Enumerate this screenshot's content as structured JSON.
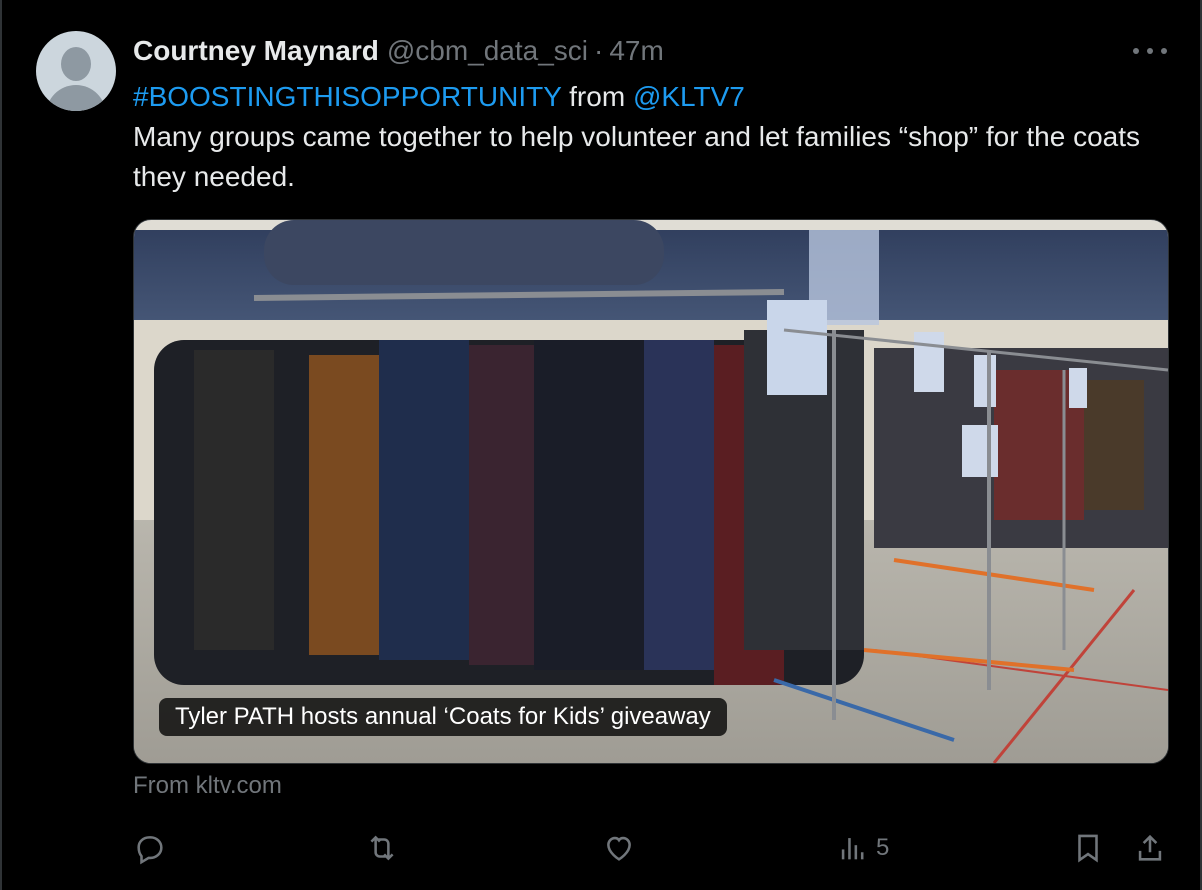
{
  "tweet": {
    "author_name": "Courtney Maynard",
    "handle": "@cbm_data_sci",
    "separator": "·",
    "time": "47m",
    "hashtag": "#BOOSTINGTHISOPPORTUNITY",
    "from_word": "from",
    "mention": "@KLTV7",
    "body": "Many groups came together to help volunteer and let families “shop” for the coats they needed."
  },
  "media": {
    "caption": "Tyler PATH hosts annual ‘Coats for Kids’ giveaway",
    "source": "From kltv.com"
  },
  "actions": {
    "reply_icon": "reply-icon",
    "retweet_icon": "retweet-icon",
    "like_icon": "like-icon",
    "views_icon": "views-icon",
    "views_count": "5",
    "bookmark_icon": "bookmark-icon",
    "share_icon": "share-icon"
  },
  "colors": {
    "background": "#000000",
    "text": "#e7e9ea",
    "muted": "#71767b",
    "link": "#1d9bf0"
  }
}
